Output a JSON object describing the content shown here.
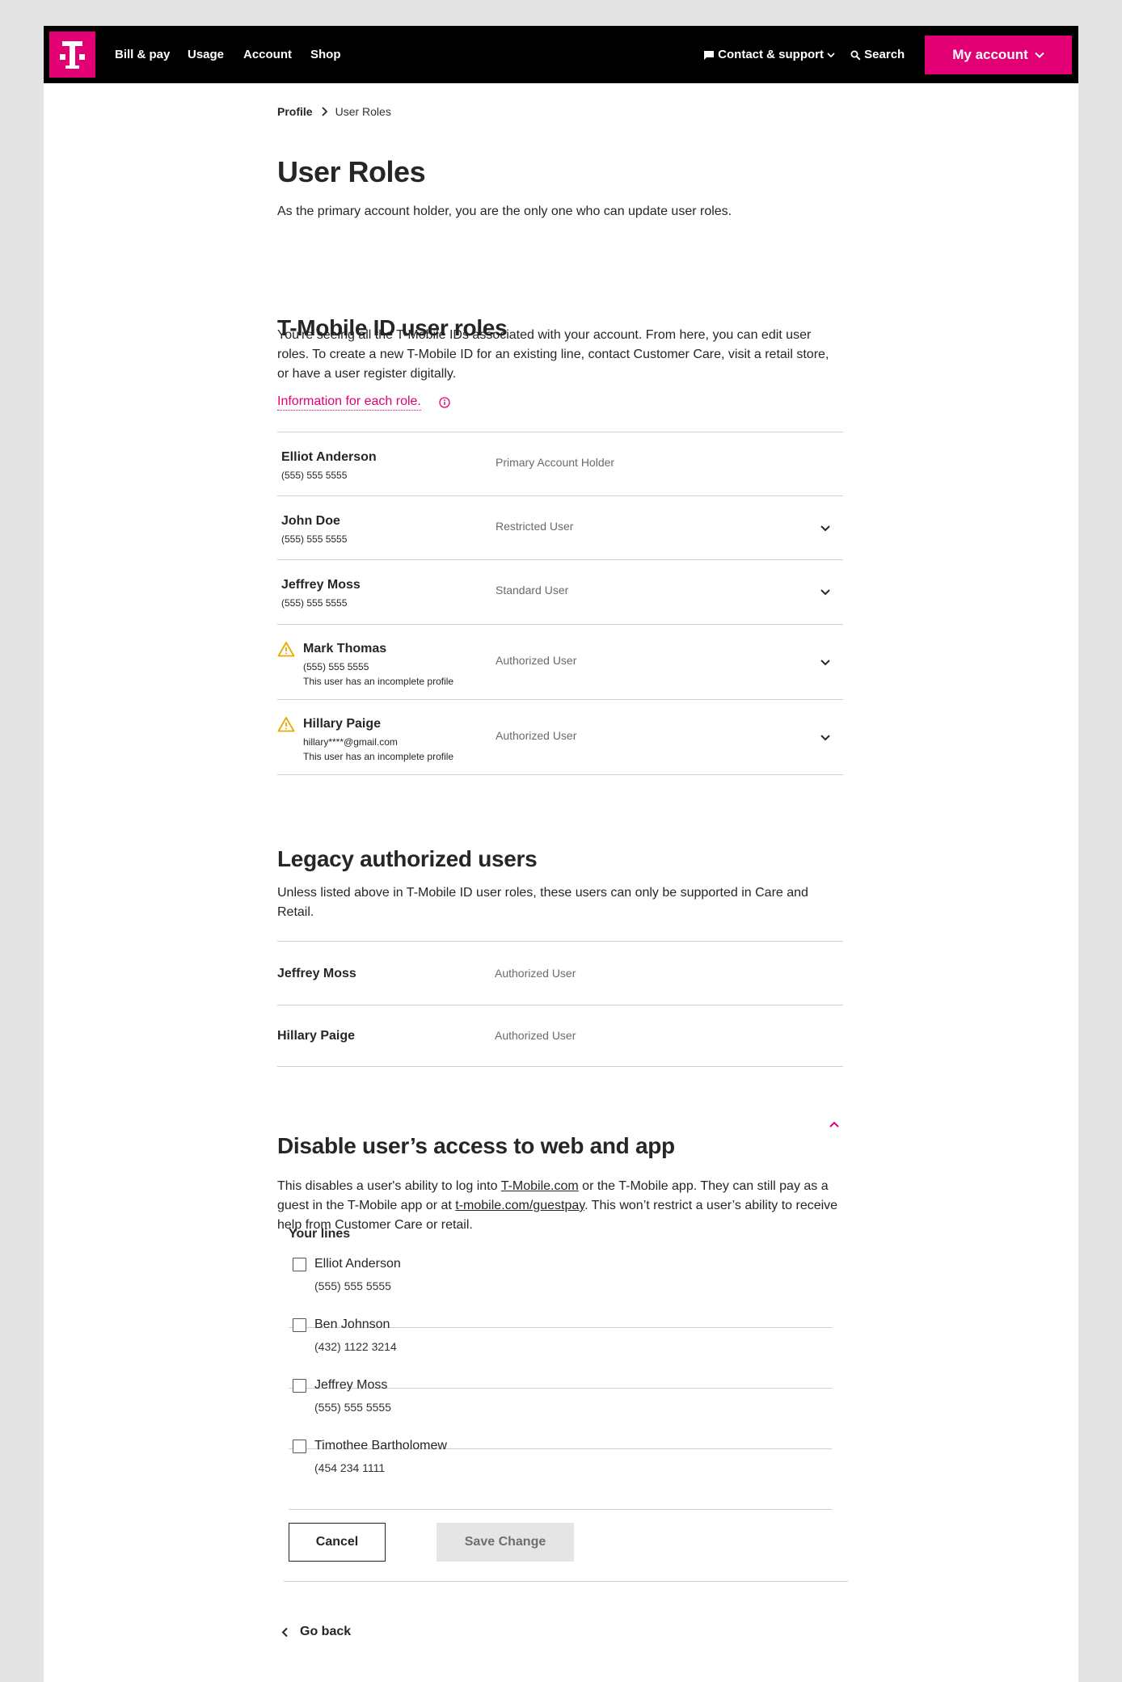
{
  "colors": {
    "brand": "#e20074",
    "nav_bg": "#000000",
    "warning": "#e7a900"
  },
  "nav": {
    "links": [
      "Bill & pay",
      "Usage",
      "Account",
      "Shop"
    ],
    "contact": "Contact & support",
    "search": "Search",
    "my_account": "My account"
  },
  "breadcrumb": {
    "parent": "Profile",
    "current": "User Roles"
  },
  "page": {
    "title": "User Roles",
    "intro": "As the primary account holder, you are the only one who can update user roles."
  },
  "tmobile_ids": {
    "title": "T-Mobile ID user roles",
    "description": "You're seeing all the T-Mobile IDs associated with your account. From here, you can edit user roles. To create a new T-Mobile ID for an existing line, contact Customer Care, visit a retail store, or have a user register digitally.",
    "info_link": "Information for each role.",
    "users": [
      {
        "name": "Elliot Anderson",
        "contact": "(555) 555 5555",
        "role": "Primary Account Holder"
      },
      {
        "name": "John Doe",
        "contact": "(555) 555 5555",
        "role": "Restricted User"
      },
      {
        "name": "Jeffrey Moss",
        "contact": "(555) 555 5555",
        "role": "Standard User"
      },
      {
        "name": "Mark Thomas",
        "contact": "(555) 555 5555",
        "role": "Authorized User",
        "warning": "This user has an incomplete profile"
      },
      {
        "name": "Hillary Paige",
        "contact": "hillary****@gmail.com",
        "role": "Authorized User",
        "warning": "This user has an incomplete profile"
      }
    ]
  },
  "legacy": {
    "title": "Legacy authorized users",
    "description": "Unless listed above in T-Mobile ID user roles, these users can only be supported in Care and Retail.",
    "users": [
      {
        "name": "Jeffrey Moss",
        "role": "Authorized User"
      },
      {
        "name": "Hillary Paige",
        "role": "Authorized User"
      }
    ]
  },
  "disable": {
    "title": "Disable user’s access to web and app",
    "desc_1": "This disables a user's ability to log into ",
    "link_1": "T-Mobile.com",
    "desc_2": " or the T-Mobile app. They can still pay as a guest in the T-Mobile app or at ",
    "link_2": "t-mobile.com/guestpay",
    "desc_3": ". This won’t restrict a user’s ability to receive help from Customer Care or retail.",
    "lines_label": "Your lines",
    "lines": [
      {
        "name": "Elliot Anderson",
        "phone": "(555) 555 5555"
      },
      {
        "name": "Ben Johnson",
        "phone": "(432) 1122 3214"
      },
      {
        "name": "Jeffrey Moss",
        "phone": "(555) 555 5555"
      },
      {
        "name": "Timothee Bartholomew",
        "phone": "(454 234 1111"
      }
    ],
    "cancel": "Cancel",
    "save": "Save Change"
  },
  "go_back": "Go back"
}
